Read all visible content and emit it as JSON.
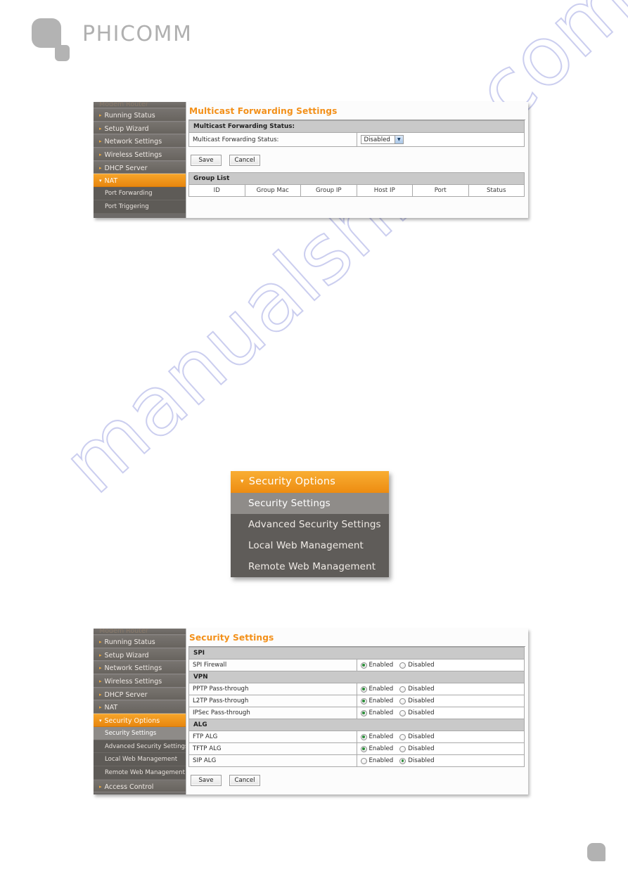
{
  "brand": {
    "name": "PHICOMM",
    "logo_icon": "phicomm-logo-icon"
  },
  "watermark": {
    "text": "manualshive.com"
  },
  "colors": {
    "accent_orange": "#f39019",
    "nav_active_orange": "#ed8c11",
    "sidebar_gray": "#6d6a68",
    "section_header_gray": "#c9c9c9",
    "radio_selected_green": "#2f8f3c",
    "brand_gray": "#b0b0b0"
  },
  "panel_top": {
    "sidebar": {
      "clipped_top_item": "Modem Router",
      "items": [
        {
          "label": "Running Status",
          "caret": "right",
          "active": false
        },
        {
          "label": "Setup Wizard",
          "caret": "right",
          "active": false
        },
        {
          "label": "Network Settings",
          "caret": "right",
          "active": false
        },
        {
          "label": "Wireless Settings",
          "caret": "right",
          "active": false
        },
        {
          "label": "DHCP Server",
          "caret": "right",
          "active": false
        },
        {
          "label": "NAT",
          "caret": "down",
          "active": true
        }
      ],
      "subitems": [
        {
          "label": "Port Forwarding",
          "selected": false
        },
        {
          "label": "Port Triggering",
          "selected": false
        }
      ]
    },
    "content": {
      "title": "Multicast Forwarding Settings",
      "section_header": "Multicast Forwarding Status:",
      "row_label": "Multicast Forwarding Status:",
      "select_value": "Disabled",
      "select_arrow_icon": "chevron-down-icon",
      "save_label": "Save",
      "cancel_label": "Cancel",
      "group_list_header": "Group List",
      "group_list_columns": [
        "ID",
        "Group Mac",
        "Group IP",
        "Host IP",
        "Port",
        "Status"
      ],
      "group_list_rows": []
    }
  },
  "float_menu": {
    "header": "Security Options",
    "header_caret_icon": "caret-down-icon",
    "items": [
      {
        "label": "Security Settings",
        "selected": true
      },
      {
        "label": "Advanced Security Settings",
        "selected": false
      },
      {
        "label": "Local Web Management",
        "selected": false
      },
      {
        "label": "Remote Web Management",
        "selected": false
      }
    ]
  },
  "panel_bottom": {
    "sidebar": {
      "clipped_top_item": "Modem Router",
      "items": [
        {
          "label": "Running Status",
          "caret": "right",
          "active": false
        },
        {
          "label": "Setup Wizard",
          "caret": "right",
          "active": false
        },
        {
          "label": "Network Settings",
          "caret": "right",
          "active": false
        },
        {
          "label": "Wireless Settings",
          "caret": "right",
          "active": false
        },
        {
          "label": "DHCP Server",
          "caret": "right",
          "active": false
        },
        {
          "label": "NAT",
          "caret": "right",
          "active": false
        },
        {
          "label": "Security Options",
          "caret": "down",
          "active": true
        }
      ],
      "subitems": [
        {
          "label": "Security Settings",
          "selected": true
        },
        {
          "label": "Advanced Security Settings",
          "selected": false
        },
        {
          "label": "Local Web Management",
          "selected": false
        },
        {
          "label": "Remote Web Management",
          "selected": false
        }
      ],
      "trailing_items": [
        {
          "label": "Access Control",
          "caret": "right",
          "active": false
        }
      ]
    },
    "content": {
      "title": "Security Settings",
      "option_enabled": "Enabled",
      "option_disabled": "Disabled",
      "sections": [
        {
          "header": "SPI",
          "rows": [
            {
              "label": "SPI Firewall",
              "value": "Enabled"
            }
          ]
        },
        {
          "header": "VPN",
          "rows": [
            {
              "label": "PPTP Pass-through",
              "value": "Enabled"
            },
            {
              "label": "L2TP Pass-through",
              "value": "Enabled"
            },
            {
              "label": "IPSec Pass-through",
              "value": "Enabled"
            }
          ]
        },
        {
          "header": "ALG",
          "rows": [
            {
              "label": "FTP ALG",
              "value": "Enabled"
            },
            {
              "label": "TFTP ALG",
              "value": "Enabled"
            },
            {
              "label": "SIP ALG",
              "value": "Disabled"
            }
          ]
        }
      ],
      "save_label": "Save",
      "cancel_label": "Cancel"
    }
  }
}
